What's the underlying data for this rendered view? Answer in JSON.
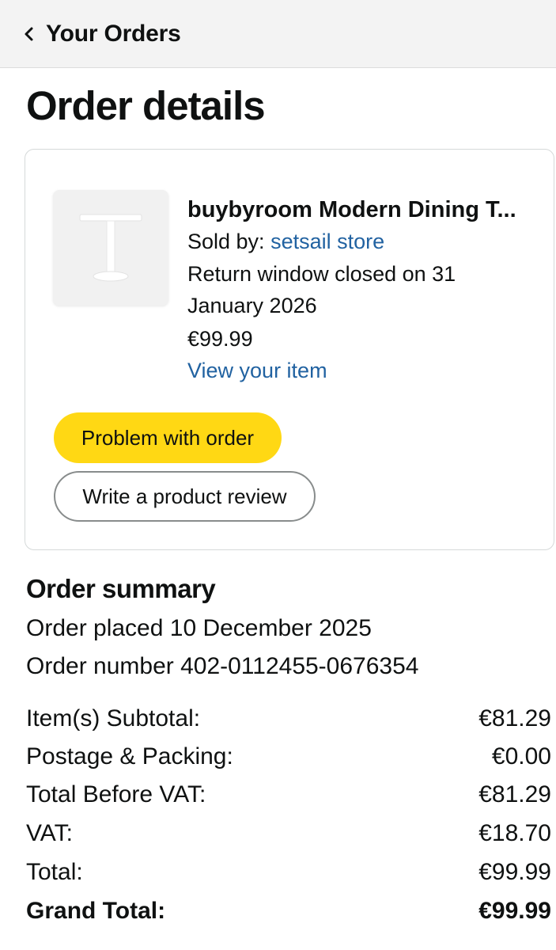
{
  "header": {
    "back_label": "Your Orders"
  },
  "page_title": "Order details",
  "item": {
    "title": "buybyroom Modern Dining T...",
    "sold_by_label": "Sold by: ",
    "seller": "setsail store",
    "return_line1": "Return window closed on 31",
    "return_line2": "January 2026",
    "price": "€99.99",
    "view_link": "View your item",
    "problem_button": "Problem with order",
    "review_button": "Write a product review"
  },
  "summary": {
    "heading": "Order summary",
    "placed": "Order placed 10 December 2025",
    "order_number": "Order number 402-0112455-0676354",
    "rows": [
      {
        "label": "Item(s) Subtotal:",
        "value": "€81.29"
      },
      {
        "label": "Postage & Packing:",
        "value": "€0.00"
      },
      {
        "label": "Total Before VAT:",
        "value": "€81.29"
      },
      {
        "label": "VAT:",
        "value": "€18.70"
      },
      {
        "label": "Total:",
        "value": "€99.99"
      },
      {
        "label": "Grand Total:",
        "value": "€99.99"
      }
    ]
  },
  "colors": {
    "accent_yellow": "#ffd814",
    "link_blue": "#2162a1",
    "header_bg": "#f3f3f3"
  },
  "icons": {
    "back": "chevron-left-icon",
    "thumbnail": "dining-table-image"
  }
}
